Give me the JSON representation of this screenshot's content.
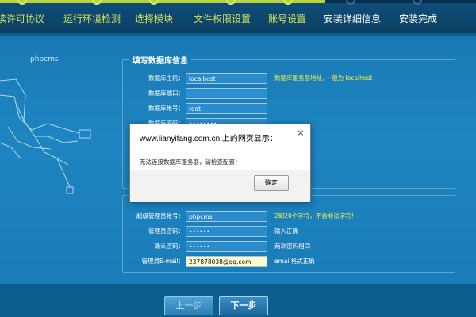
{
  "steps": [
    {
      "label": "读许可协议",
      "done": true
    },
    {
      "label": "运行环境检测",
      "done": true
    },
    {
      "label": "选择模块",
      "done": true
    },
    {
      "label": "文件权限设置",
      "done": true
    },
    {
      "label": "账号设置",
      "done": true
    },
    {
      "label": "安装详细信息",
      "done": false
    },
    {
      "label": "安装完成",
      "done": false
    }
  ],
  "brand": "phpcms",
  "db_section": {
    "legend": "填写数据库信息",
    "fields": [
      {
        "label": "数据库主机：",
        "value": "localhost",
        "hint": "数据库服务器地址, 一般为 localhost"
      },
      {
        "label": "数据库端口：",
        "value": "",
        "hint": ""
      },
      {
        "label": "数据库帐号：",
        "value": "root",
        "hint": ""
      },
      {
        "label": "数据库密码：",
        "value": "••••••••",
        "hint": ""
      }
    ]
  },
  "admin_section": {
    "fields": [
      {
        "label": "超级管理员帐号：",
        "value": "phpcms",
        "hint": "2到20个字符，不含非法字符!"
      },
      {
        "label": "管理员密码：",
        "value": "••••••",
        "hint": "输入正确"
      },
      {
        "label": "确认密码：",
        "value": "••••••",
        "hint": "两次密码相同"
      },
      {
        "label": "管理员E-mail：",
        "value": "237878038@qq.com",
        "hint": "email格式正确"
      }
    ]
  },
  "dialog": {
    "title": "www.lianyifang.com.cn 上的网页显示：",
    "close": "×",
    "message": "无法连接数据库服务器，请检查配置！",
    "ok": "确定"
  },
  "buttons": {
    "prev": "上一步",
    "next": "下一步"
  },
  "colors": {
    "accent_done": "#b8d23a",
    "background": "#0d5d8e",
    "panel": "#1d85c1",
    "hint_yellow": "#f5f04e"
  }
}
